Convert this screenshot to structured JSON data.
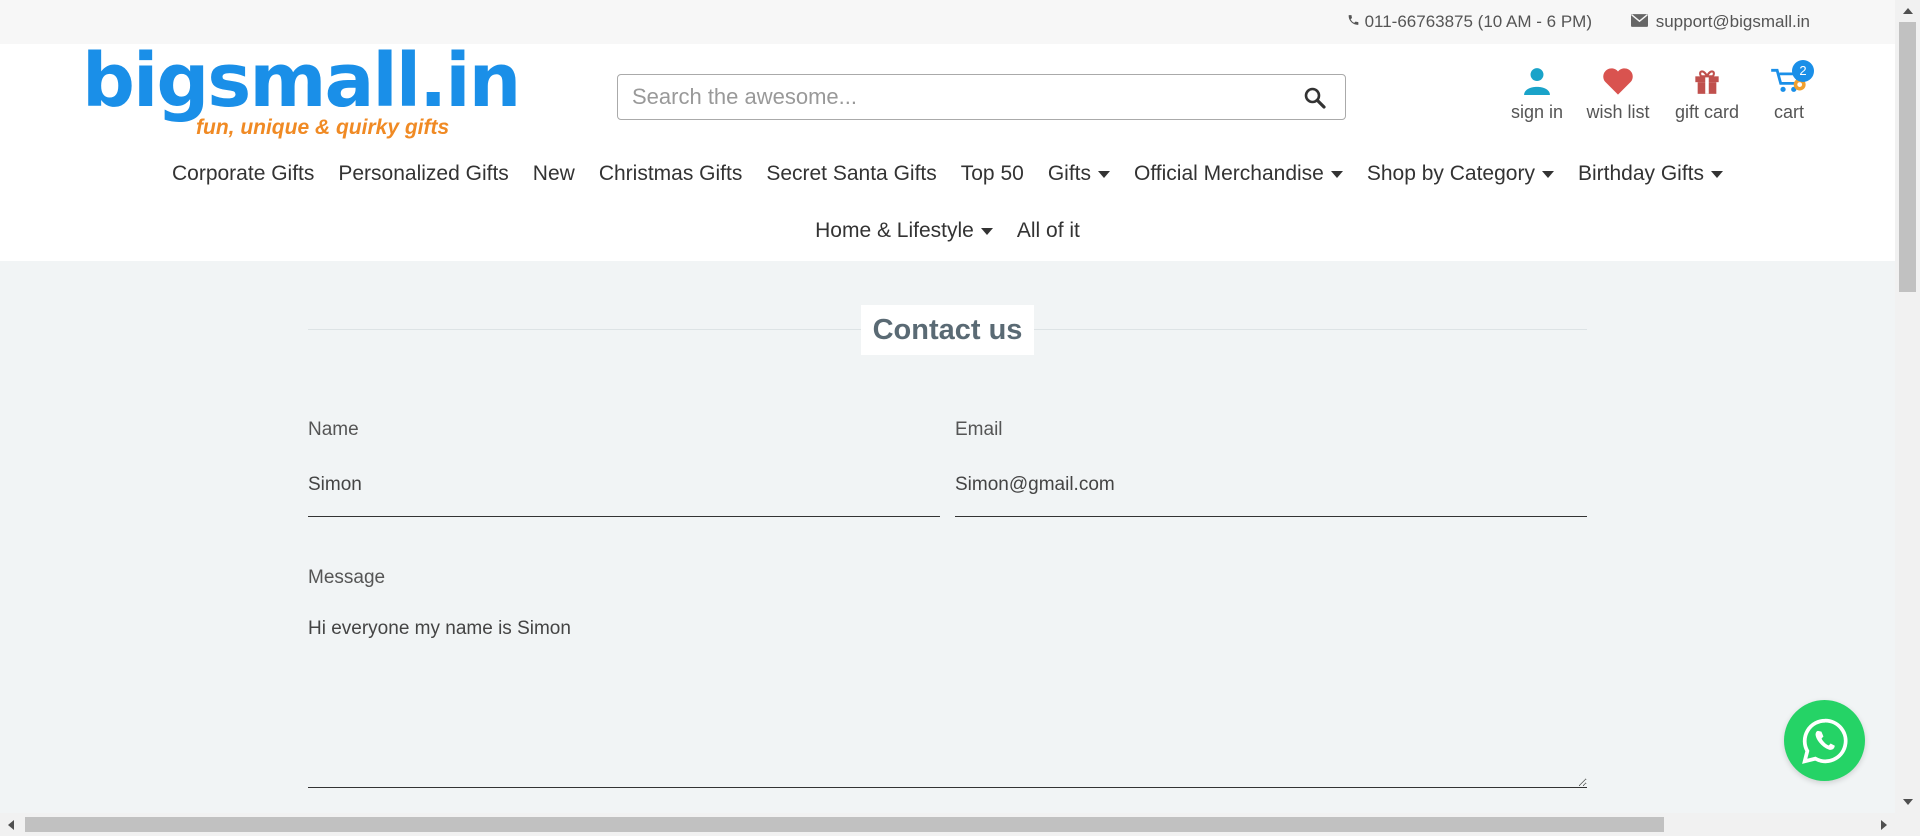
{
  "topbar": {
    "phone": "011-66763875 (10 AM - 6 PM)",
    "email": "support@bigsmall.in"
  },
  "logo": {
    "name": "bigsmall.in",
    "tagline": "fun, unique & quirky gifts",
    "colors": {
      "main": "#1a8fe8",
      "tagline": "#f08a24"
    }
  },
  "search": {
    "placeholder": "Search the awesome..."
  },
  "header_icons": {
    "sign_in": "sign in",
    "wish_list": "wish list",
    "gift_card": "gift card",
    "cart": "cart",
    "cart_count": "2"
  },
  "nav": {
    "row1": [
      {
        "label": "Corporate Gifts",
        "dropdown": false
      },
      {
        "label": "Personalized Gifts",
        "dropdown": false
      },
      {
        "label": "New",
        "dropdown": false
      },
      {
        "label": "Christmas Gifts",
        "dropdown": false
      },
      {
        "label": "Secret Santa Gifts",
        "dropdown": false
      },
      {
        "label": "Top 50",
        "dropdown": false
      },
      {
        "label": "Gifts",
        "dropdown": true
      },
      {
        "label": "Official Merchandise",
        "dropdown": true
      },
      {
        "label": "Shop by Category",
        "dropdown": true
      },
      {
        "label": "Birthday Gifts",
        "dropdown": true
      }
    ],
    "row2": [
      {
        "label": "Home & Lifestyle",
        "dropdown": true
      },
      {
        "label": "All of it",
        "dropdown": false
      }
    ]
  },
  "contact": {
    "title": "Contact us",
    "name_label": "Name",
    "name_value": "Simon",
    "email_label": "Email",
    "email_value": "Simon@gmail.com",
    "message_label": "Message",
    "message_value": "Hi everyone my name is Simon"
  },
  "colors": {
    "accent": "#1a8fe8",
    "whatsapp": "#25d366",
    "heart": "#d9534f",
    "gift": "#c0504d"
  }
}
